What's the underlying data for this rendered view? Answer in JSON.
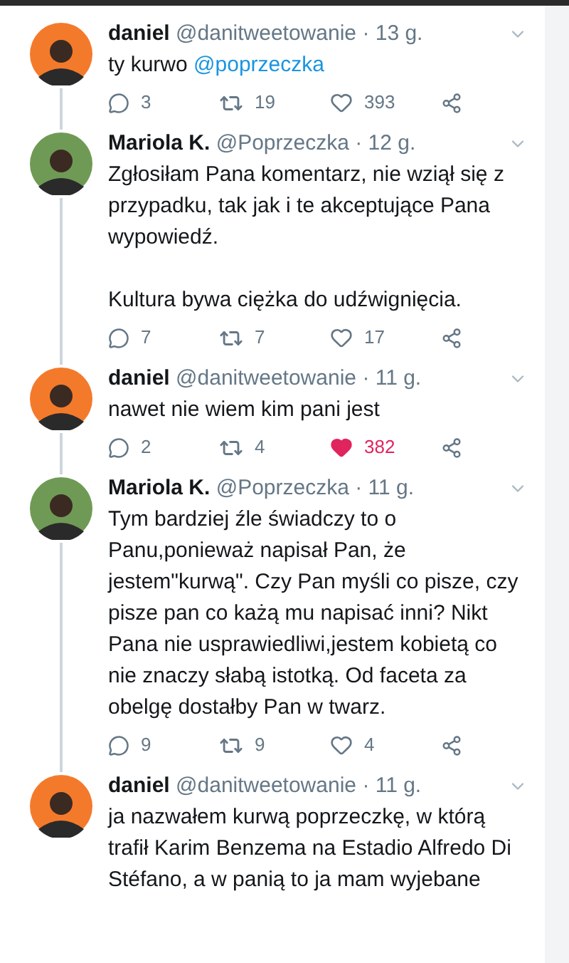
{
  "tweets": [
    {
      "name": "daniel",
      "handle": "@danitweetowanie",
      "time": "· 13 g.",
      "avatar": {
        "color": "#f47a2b"
      },
      "paragraphs": [
        "ty kurwo"
      ],
      "mention": "@poprzeczka",
      "connected_below": true,
      "actions": {
        "replies": "3",
        "retweets": "19",
        "likes": "393",
        "liked": false
      }
    },
    {
      "name": "Mariola K.",
      "handle": "@Poprzeczka",
      "time": "· 12 g.",
      "avatar": {
        "color": "#6f9a55"
      },
      "paragraphs": [
        "Zgłosiłam Pana komentarz, nie wziął się z przypadku, tak jak i te akceptujące Pana wypowiedź.",
        "Kultura bywa ciężka do udźwignięcia."
      ],
      "connected_below": true,
      "actions": {
        "replies": "7",
        "retweets": "7",
        "likes": "17",
        "liked": false
      }
    },
    {
      "name": "daniel",
      "handle": "@danitweetowanie",
      "time": "· 11 g.",
      "avatar": {
        "color": "#f47a2b"
      },
      "paragraphs": [
        "nawet nie wiem kim pani jest"
      ],
      "connected_below": true,
      "actions": {
        "replies": "2",
        "retweets": "4",
        "likes": "382",
        "liked": true
      }
    },
    {
      "name": "Mariola K.",
      "handle": "@Poprzeczka",
      "time": "· 11 g.",
      "avatar": {
        "color": "#6f9a55"
      },
      "paragraphs": [
        "Tym bardziej źle świadczy to o Panu,ponieważ napisał Pan, że jestem\"kurwą\". Czy Pan myśli co pisze, czy pisze pan co każą mu napisać inni? Nikt Pana nie usprawiedliwi,jestem kobietą co nie znaczy słabą istotką. Od faceta za obelgę dostałby Pan w twarz."
      ],
      "connected_below": true,
      "actions": {
        "replies": "9",
        "retweets": "9",
        "likes": "4",
        "liked": false
      }
    },
    {
      "name": "daniel",
      "handle": "@danitweetowanie",
      "time": "· 11 g.",
      "avatar": {
        "color": "#f47a2b"
      },
      "paragraphs": [
        "ja nazwałem kurwą poprzeczkę, w którą trafił Karim Benzema na Estadio Alfredo Di Stéfano, a w panią to ja mam wyjebane"
      ],
      "connected_below": false
    }
  ]
}
